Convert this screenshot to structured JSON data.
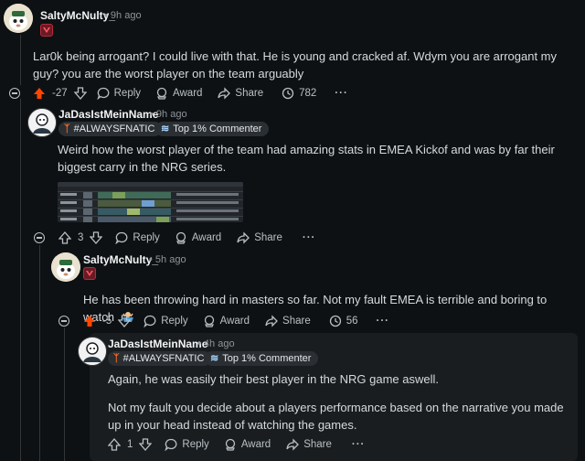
{
  "comments": [
    {
      "author": "SaltyMcNulty_",
      "time": "9h ago",
      "body": "Lar0k being arrogant? I could live with that. He is young and cracked af. Wdym you are arrogant my guy? you are the worst player on the team arguably",
      "votes": "-27",
      "reply_label": "Reply",
      "award_label": "Award",
      "share_label": "Share",
      "awards_count": "782"
    },
    {
      "author": "JaDasIstMeinName",
      "time": "9h ago",
      "flair_team": "#ALWAYSFNATIC",
      "flair_badge": "Top 1% Commenter",
      "body": "Weird how the worst player of the team had amazing stats in EMEA Kickof and was by far their biggest carry in the NRG series.",
      "votes": "3",
      "reply_label": "Reply",
      "award_label": "Award",
      "share_label": "Share"
    },
    {
      "author": "SaltyMcNulty_",
      "time": "5h ago",
      "body": "He has been throwing hard in masters so far. Not my fault EMEA is terrible and boring to watch",
      "votes": "-5",
      "reply_label": "Reply",
      "award_label": "Award",
      "share_label": "Share",
      "awards_count": "56"
    },
    {
      "author": "JaDasIstMeinName",
      "time": "4h ago",
      "flair_team": "#ALWAYSFNATIC",
      "flair_badge": "Top 1% Commenter",
      "body_p1": "Again, he was easily their best player in the NRG game aswell.",
      "body_p2": "Not my fault you decide about a players performance based on the narrative you made up in your head instead of watching the games.",
      "votes": "1",
      "reply_label": "Reply",
      "award_label": "Award",
      "share_label": "Share"
    }
  ],
  "separator": "•",
  "colors": {
    "background": "#0e1113",
    "downvote_active": "#ff4500",
    "highlight": "#1a1d1f",
    "fnatic_orange": "#ff6b1a"
  },
  "icons": [
    "upvote-icon",
    "downvote-icon",
    "reply-icon",
    "award-icon",
    "share-icon",
    "awards-clock-icon",
    "more-icon",
    "collapse-icon"
  ]
}
